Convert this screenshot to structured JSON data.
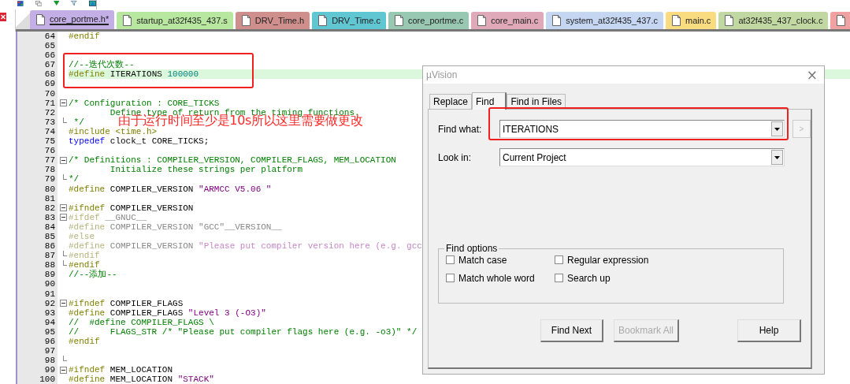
{
  "editor_tabs": [
    {
      "label": "core_portme.h*",
      "color": "#c4aee6",
      "selected": true
    },
    {
      "label": "startup_at32f435_437.s",
      "color": "#b8e8a0",
      "selected": false
    },
    {
      "label": "DRV_Time.h",
      "color": "#cf8f8c",
      "selected": false
    },
    {
      "label": "DRV_Time.c",
      "color": "#5fc6d2",
      "selected": false
    },
    {
      "label": "core_portme.c",
      "color": "#98c8b2",
      "selected": false
    },
    {
      "label": "core_main.c",
      "color": "#dfa9ba",
      "selected": false
    },
    {
      "label": "system_at32f435_437.c",
      "color": "#c4d6f2",
      "selected": false
    },
    {
      "label": "main.c",
      "color": "#f9dc80",
      "selected": false
    },
    {
      "label": "at32f435_437_clock.c",
      "color": "#c2d8a2",
      "selected": false
    },
    {
      "color": "#f0a2a2",
      "selected": false
    }
  ],
  "editor": {
    "lines": [
      {
        "number": "64",
        "collapsible": false,
        "fold_end": false,
        "current": false,
        "segments": [
          {
            "text": "#endif",
            "kind": "preproc"
          }
        ]
      },
      {
        "number": "65",
        "collapsible": false,
        "fold_end": false,
        "current": false
      },
      {
        "number": "66",
        "collapsible": false,
        "fold_end": false,
        "current": false
      },
      {
        "number": "67",
        "collapsible": false,
        "fold_end": false,
        "current": false,
        "segments": [
          {
            "text": "//--迭代次数--",
            "kind": "comment"
          }
        ]
      },
      {
        "number": "68",
        "collapsible": false,
        "fold_end": false,
        "current": true,
        "segments": [
          {
            "text": "#define",
            "kind": "preproc"
          },
          {
            "text": " ITERATIONS ",
            "kind": "plain"
          },
          {
            "text": "100000",
            "kind": "number"
          }
        ]
      },
      {
        "number": "69",
        "collapsible": false,
        "fold_end": false,
        "current": false
      },
      {
        "number": "70",
        "collapsible": false,
        "fold_end": false,
        "current": false
      },
      {
        "number": "71",
        "collapsible": true,
        "fold_end": false,
        "current": false,
        "segments": [
          {
            "text": "/* Configuration : CORE_TICKS",
            "kind": "comment"
          }
        ]
      },
      {
        "number": "72",
        "collapsible": false,
        "fold_end": false,
        "current": false,
        "segments": [
          {
            "text": "        Define type of return from the timing functions.",
            "kind": "comment"
          }
        ]
      },
      {
        "number": "73",
        "collapsible": false,
        "fold_end": true,
        "current": false,
        "segments": [
          {
            "text": " */",
            "kind": "comment"
          }
        ]
      },
      {
        "number": "74",
        "collapsible": false,
        "fold_end": false,
        "current": false,
        "segments": [
          {
            "text": "#include <time.h>",
            "kind": "preproc"
          }
        ]
      },
      {
        "number": "75",
        "collapsible": false,
        "fold_end": false,
        "current": false,
        "segments": [
          {
            "text": "typedef",
            "kind": "keyword"
          },
          {
            "text": " clock_t CORE_TICKS;",
            "kind": "plain"
          }
        ]
      },
      {
        "number": "76",
        "collapsible": false,
        "fold_end": false,
        "current": false
      },
      {
        "number": "77",
        "collapsible": true,
        "fold_end": false,
        "current": false,
        "segments": [
          {
            "text": "/* Definitions : COMPILER_VERSION, COMPILER_FLAGS, MEM_LOCATION",
            "kind": "comment"
          }
        ]
      },
      {
        "number": "78",
        "collapsible": false,
        "fold_end": false,
        "current": false,
        "segments": [
          {
            "text": "        Initialize these strings per platform",
            "kind": "comment"
          }
        ]
      },
      {
        "number": "79",
        "collapsible": false,
        "fold_end": true,
        "current": false,
        "segments": [
          {
            "text": "*/",
            "kind": "comment"
          }
        ]
      },
      {
        "number": "80",
        "collapsible": false,
        "fold_end": false,
        "current": false,
        "segments": [
          {
            "text": "#define",
            "kind": "preproc"
          },
          {
            "text": " COMPILER_VERSION ",
            "kind": "plain"
          },
          {
            "text": "\"ARMCC V5.06 \"",
            "kind": "string"
          }
        ]
      },
      {
        "number": "81",
        "collapsible": false,
        "fold_end": false,
        "current": false
      },
      {
        "number": "82",
        "collapsible": true,
        "fold_end": false,
        "current": false,
        "segments": [
          {
            "text": "#ifndef",
            "kind": "preproc"
          },
          {
            "text": " COMPILER_VERSION",
            "kind": "plain"
          }
        ]
      },
      {
        "number": "83",
        "collapsible": true,
        "fold_end": false,
        "current": false,
        "segments": [
          {
            "text": "#ifdef",
            "kind": "inactive_preproc"
          },
          {
            "text": " __GNUC__",
            "kind": "inactive"
          }
        ]
      },
      {
        "number": "84",
        "collapsible": false,
        "fold_end": false,
        "current": false,
        "segments": [
          {
            "text": "#define",
            "kind": "inactive_preproc"
          },
          {
            "text": " COMPILER_VERSION \"GCC\"__VERSION__",
            "kind": "inactive"
          }
        ]
      },
      {
        "number": "85",
        "collapsible": false,
        "fold_end": false,
        "current": false,
        "segments": [
          {
            "text": "#else",
            "kind": "inactive_preproc"
          }
        ]
      },
      {
        "number": "86",
        "collapsible": false,
        "fold_end": false,
        "current": false,
        "segments": [
          {
            "text": "#define",
            "kind": "inactive_preproc"
          },
          {
            "text": " COMPILER_VERSION ",
            "kind": "inactive"
          },
          {
            "text": "\"Please put compiler version here (e.g. gcc",
            "kind": "inactive_string"
          }
        ]
      },
      {
        "number": "87",
        "collapsible": false,
        "fold_end": true,
        "current": false,
        "segments": [
          {
            "text": "#endif",
            "kind": "inactive_preproc"
          }
        ]
      },
      {
        "number": "88",
        "collapsible": false,
        "fold_end": true,
        "current": false,
        "segments": [
          {
            "text": "#endif",
            "kind": "preproc"
          }
        ]
      },
      {
        "number": "89",
        "collapsible": false,
        "fold_end": false,
        "current": false,
        "segments": [
          {
            "text": "//--添加--",
            "kind": "comment"
          }
        ]
      },
      {
        "number": "90",
        "collapsible": false,
        "fold_end": false,
        "current": false
      },
      {
        "number": "91",
        "collapsible": false,
        "fold_end": false,
        "current": false
      },
      {
        "number": "92",
        "collapsible": true,
        "fold_end": false,
        "current": false,
        "segments": [
          {
            "text": "#ifndef",
            "kind": "preproc"
          },
          {
            "text": " COMPILER_FLAGS",
            "kind": "plain"
          }
        ]
      },
      {
        "number": "93",
        "collapsible": false,
        "fold_end": false,
        "current": false,
        "segments": [
          {
            "text": "#define",
            "kind": "preproc"
          },
          {
            "text": " COMPILER_FLAGS ",
            "kind": "plain"
          },
          {
            "text": "\"Level 3 (-O3)\"",
            "kind": "string"
          }
        ]
      },
      {
        "number": "94",
        "collapsible": false,
        "fold_end": false,
        "current": false,
        "segments": [
          {
            "text": "//  #define COMPILER_FLAGS \\",
            "kind": "comment"
          }
        ]
      },
      {
        "number": "95",
        "collapsible": false,
        "fold_end": false,
        "current": false,
        "segments": [
          {
            "text": "//      FLAGS_STR /* \"Please put compiler flags here (e.g. -o3)\" */",
            "kind": "comment"
          }
        ]
      },
      {
        "number": "96",
        "collapsible": false,
        "fold_end": false,
        "current": false,
        "segments": [
          {
            "text": "#endif",
            "kind": "preproc"
          }
        ]
      },
      {
        "number": "97",
        "collapsible": false,
        "fold_end": false,
        "current": false
      },
      {
        "number": "98",
        "collapsible": false,
        "fold_end": true,
        "current": false
      },
      {
        "number": "99",
        "collapsible": true,
        "fold_end": false,
        "current": false,
        "segments": [
          {
            "text": "#ifndef",
            "kind": "preproc"
          },
          {
            "text": " MEM_LOCATION",
            "kind": "plain"
          }
        ]
      },
      {
        "number": "100",
        "collapsible": false,
        "fold_end": false,
        "current": false,
        "segments": [
          {
            "text": "#define",
            "kind": "preproc"
          },
          {
            "text": " MEM_LOCATION ",
            "kind": "plain"
          },
          {
            "text": "\"STACK\"",
            "kind": "string"
          }
        ]
      }
    ]
  },
  "annotation": {
    "note": "由于运行时间至少是10s所以这里需要做更改"
  },
  "find_dialog": {
    "title": "µVision",
    "close": "×",
    "tabs": [
      {
        "label": "Replace",
        "selected": false
      },
      {
        "label": "Find",
        "selected": true
      },
      {
        "label": "Find in Files",
        "selected": false
      }
    ],
    "fields": [
      {
        "label": "Find what:",
        "value": "ITERATIONS"
      },
      {
        "label": "Look in:",
        "value": "Current Project"
      }
    ],
    "history_button": {
      "label": ">",
      "disabled": true
    },
    "options_group": {
      "title": "Find options",
      "options": [
        {
          "label": "Match case",
          "checked": false
        },
        {
          "label": "Regular expression",
          "checked": false
        },
        {
          "label": "Match whole word",
          "checked": false
        },
        {
          "label": "Search up",
          "checked": false
        }
      ]
    },
    "buttons": [
      {
        "label": "Find Next",
        "disabled": false
      },
      {
        "label": "Bookmark All",
        "disabled": true
      },
      {
        "label": "Help",
        "disabled": false
      }
    ]
  }
}
